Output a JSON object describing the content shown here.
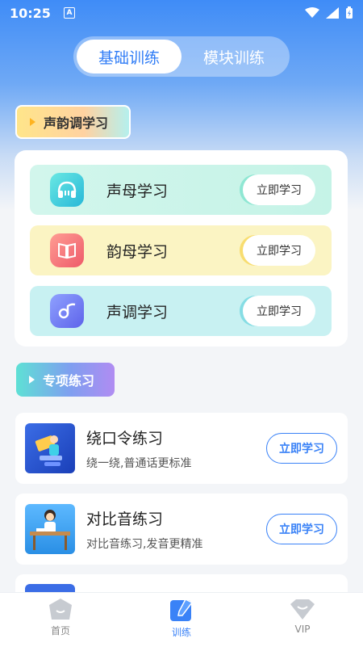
{
  "status": {
    "time": "10:25",
    "a_badge": "A"
  },
  "segment": {
    "tabs": [
      {
        "label": "基础训练",
        "active": true
      },
      {
        "label": "模块训练",
        "active": false
      }
    ]
  },
  "section1": {
    "title": "声韵调学习"
  },
  "study_rows": [
    {
      "label": "声母学习",
      "button": "立即学习",
      "icon": "headphones-icon"
    },
    {
      "label": "韵母学习",
      "button": "立即学习",
      "icon": "book-icon"
    },
    {
      "label": "声调学习",
      "button": "立即学习",
      "icon": "music-note-icon"
    }
  ],
  "section2": {
    "title": "专项练习"
  },
  "practice": [
    {
      "title": "绕口令练习",
      "subtitle": "绕一绕,普通话更标准",
      "button": "立即学习"
    },
    {
      "title": "对比音练习",
      "subtitle": "对比音练习,发音更精准",
      "button": "立即学习"
    }
  ],
  "tabbar": [
    {
      "label": "首页",
      "icon": "home-icon",
      "active": false
    },
    {
      "label": "训练",
      "icon": "pencil-icon",
      "active": true
    },
    {
      "label": "VIP",
      "icon": "vip-crown-icon",
      "active": false
    }
  ],
  "colors": {
    "accent": "#3a82f7"
  }
}
